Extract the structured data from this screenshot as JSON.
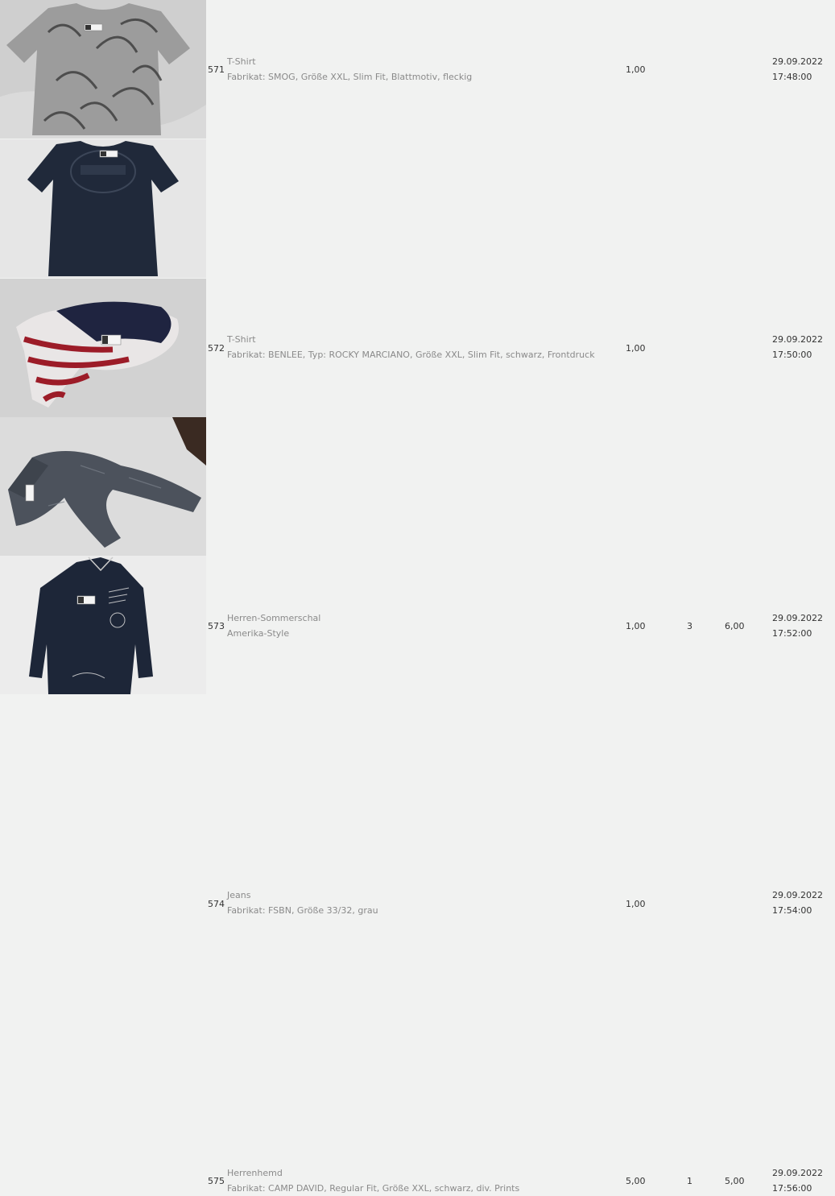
{
  "items": [
    {
      "number": "571",
      "title": "T-Shirt",
      "details": "Fabrikat: SMOG, Größe XXL, Slim Fit, Blattmotiv, fleckig",
      "quantity": "1,00",
      "count": "",
      "price": "",
      "date": "29.09.2022",
      "time": "17:48:00",
      "image": "grey-leaf-pattern-tshirt"
    },
    {
      "number": "572",
      "title": "T-Shirt",
      "details": "Fabrikat: BENLEE, Typ: ROCKY MARCIANO, Größe XXL, Slim Fit, schwarz, Frontdruck",
      "quantity": "1,00",
      "count": "",
      "price": "",
      "date": "29.09.2022",
      "time": "17:50:00",
      "image": "black-printed-tshirt"
    },
    {
      "number": "573",
      "title": "Herren-Sommerschal",
      "details": "Amerika-Style",
      "quantity": "1,00",
      "count": "3",
      "price": "6,00",
      "date": "29.09.2022",
      "time": "17:52:00",
      "image": "american-flag-scarf"
    },
    {
      "number": "574",
      "title": "Jeans",
      "details": "Fabrikat: FSBN, Größe 33/32, grau",
      "quantity": "1,00",
      "count": "",
      "price": "",
      "date": "29.09.2022",
      "time": "17:54:00",
      "image": "grey-denim-jeans"
    },
    {
      "number": "575",
      "title": "Herrenhemd",
      "details": "Fabrikat: CAMP DAVID, Regular Fit, Größe XXL, schwarz, div. Prints",
      "quantity": "5,00",
      "count": "1",
      "price": "5,00",
      "date": "29.09.2022",
      "time": "17:56:00",
      "image": "navy-printed-shirt"
    }
  ]
}
